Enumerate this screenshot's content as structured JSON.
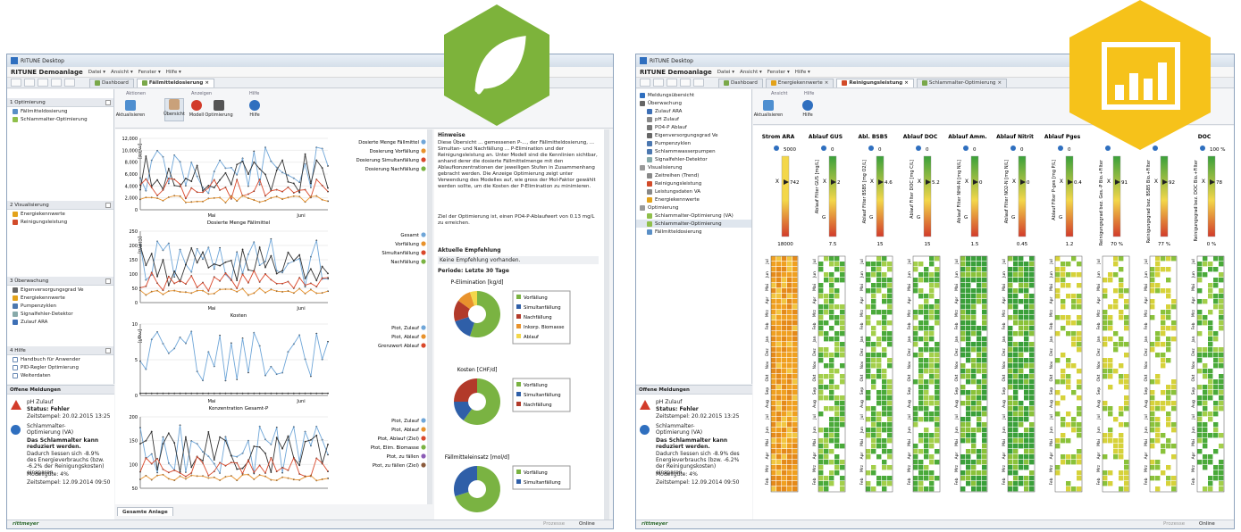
{
  "colors": {
    "green_badge": "#7db33b",
    "yellow_badge": "#f6c21a",
    "blue_line": "#6fa6d8",
    "black_line": "#333333",
    "red_line": "#d9482b",
    "orange_line": "#e8922c",
    "green_line": "#7ab342"
  },
  "left": {
    "title": "RITUNE Desktop",
    "app_name": "RITUNE Demoanlage",
    "menu": [
      "Datei ▾",
      "Ansicht ▾",
      "Fenster ▾",
      "Hilfe ▾"
    ],
    "tabs": [
      "Dashboard",
      "Fällmitteldosierung"
    ],
    "ribbon": {
      "groups": [
        "Aktionen",
        "Anzeigen",
        "Hilfe"
      ],
      "buttons": [
        "Aktualisieren",
        "Übersicht",
        "Modell",
        "Optimierung",
        "Hilfe"
      ]
    },
    "sidebar": [
      {
        "title": "1 Optimierung",
        "items": [
          "Fällmitteldosierung",
          "Schlammalter-Optimierung"
        ]
      },
      {
        "title": "2 Visualisierung",
        "items": [
          "Energiekennwerte",
          "Reinigungsleistung"
        ]
      },
      {
        "title": "3 Überwachung",
        "items": [
          "Eigenversorgungsgrad Ve",
          "Energiekennwerte",
          "Pumpenzyklen",
          "Signalfehler-Detektor",
          "Zulauf ARA"
        ]
      },
      {
        "title": "4 Hilfe",
        "items": [
          "Handbuch für Anwender",
          "PID-Regler Optimierung",
          "Weiterdaten"
        ]
      }
    ],
    "notes": {
      "title": "Offene Meldungen",
      "n1": {
        "name": "pH Zulauf",
        "status": "Status: Fehler",
        "time": "Zeitstempel: 20.02.2015 13:25"
      },
      "n2": {
        "name": "Schlammalter-Optimierung (VA)",
        "bold": "Das Schlammalter kann reduziert werden.",
        "text": "Dadurch liessen sich -8.9% des Energieverbrauchs (bzw. -6.2% der Reinigungskosten) einsparen.",
        "quality": "Modellgüte: 4%",
        "time": "Zeitstempel: 12.09.2014 09:50"
      }
    },
    "charts": [
      {
        "xlabel": "Dosierte Menge Fällmittel",
        "month1": "Mai",
        "month2": "Juni",
        "yticks": [
          "12,000",
          "10,000",
          "8,000",
          "6,000",
          "4,000",
          "2,000",
          "0"
        ],
        "unit": "[m3/d]",
        "legend": [
          "Dosierte Menge Fällmittel",
          "Dosierung Vorfällung",
          "Dosierung Simultanfällung",
          "Dosierung Nachfällung"
        ]
      },
      {
        "xlabel": "Kosten",
        "month1": "Mai",
        "month2": "Juni",
        "yticks": [
          "250",
          "200",
          "150",
          "100",
          "50",
          "0"
        ],
        "unit": "[CHF/d]",
        "legend": [
          "Gesamt",
          "Vorfällung",
          "Simultanfällung",
          "Nachfällung"
        ]
      },
      {
        "xlabel": "Konzentration Gesamt-P",
        "month1": "Mai",
        "month2": "Juni",
        "yticks": [
          "10",
          "5",
          "0"
        ],
        "unit": "[mg/l]",
        "legend": [
          "Ptot, Zulauf",
          "Ptot, Ablauf",
          "Grenzwert Ablauf"
        ]
      },
      {
        "xlabel": "",
        "month1": "",
        "month2": "",
        "yticks": [
          "200",
          "150",
          "100",
          "50"
        ],
        "unit": "",
        "legend": [
          "Ptot, Zulauf",
          "Ptot, Ablauf",
          "Ptot, Ablauf (Ziel)",
          "Ptot, Elim. Biomasse",
          "Ptot, zu fällen",
          "Ptot, zu fällen (Ziel)"
        ]
      }
    ],
    "right": {
      "heading": "Hinweise",
      "text": "Diese Übersicht ... gemessenen P-..., der Fällmitteldosierung, ... Simultan- und Nachfällung ... P-Elimination und der Reinigungsleistung an. Unter Modell sind die Kennlinien sichtbar, anhand derer die dosierte Fällmittelmenge mit den Ablaufkonzentrationen der jeweiligen Stufen in Zusammenhang gebracht werden. Die Anzeige Optimierung zeigt unter Verwendung des Modelles auf, wie gross der Mol-Faktor gewählt werden sollte, um die Kosten der P-Elimination zu minimieren.",
      "goal": "Ziel der Optimierung ist, einen PO4-P-Ablaufwert von 0.13 mg/L zu erreichen.",
      "reco_title": "Aktuelle Empfehlung",
      "reco_text": "Keine Empfehlung vorhanden.",
      "period": "Periode: Letzte 30 Tage",
      "pies": [
        {
          "title": "P-Elimination [kg/d]",
          "legend": [
            "Vorfällung",
            "Simultanfällung",
            "Nachfällung",
            "Inkorp. Biomasse",
            "Ablauf"
          ]
        },
        {
          "title": "Kosten [CHF/d]",
          "legend": [
            "Vorfällung",
            "Simultanfällung",
            "Nachfällung"
          ]
        },
        {
          "title": "Fällmitteleinsatz [mol/d]",
          "legend": [
            "Vorfällung",
            "Simultanfällung"
          ]
        }
      ]
    },
    "bottom_tab": "Gesamte Anlage",
    "status": {
      "brand": "rittmeyer",
      "proc": "Prozesse",
      "online": "Online"
    }
  },
  "right": {
    "title": "RITUNE Desktop",
    "app_name": "RITUNE Demoanlage",
    "menu": [
      "Datei ▾",
      "Ansicht ▾",
      "Fenster ▾",
      "Hilfe ▾"
    ],
    "tabs": [
      "Dashboard",
      "Energiekennwerte",
      "Reinigungsleistung",
      "Schlammalter-Optimierung"
    ],
    "ribbon": {
      "groups": [
        "Ansicht",
        "Hilfe"
      ],
      "buttons": [
        "Aktualisieren",
        "Hilfe"
      ]
    },
    "tree": [
      "Meldungsübersicht",
      "Überwachung",
      "Zulauf ARA",
      "pH Zulauf",
      "PO4-P Ablauf",
      "Eigenversorgungsgrad Ve",
      "Pumpenzyklen",
      "Schlammwasserpumpen",
      "Signalfehler-Detektor",
      "Visualisierung",
      "Zeitreihen (Trend)",
      "Reinigungsleistung",
      "Leistungsdaten VA",
      "Energiekennwerte",
      "Optimierung",
      "Schlammalter-Optimierung (VA)",
      "Schlammalter-Optimierung",
      "Fällmitteldosierung"
    ],
    "notes": {
      "title": "Offene Meldungen",
      "n1": {
        "name": "pH Zulauf",
        "status": "Status: Fehler",
        "time": "Zeitstempel: 20.02.2015 13:25"
      },
      "n2": {
        "name": "Schlammalter-Optimierung (VA)",
        "bold": "Das Schlammalter kann reduziert werden.",
        "text": "Dadurch liessen sich -8.9% des Energieverbrauchs (bzw. -6.2% der Reinigungskosten) einsparen.",
        "quality": "Modellgüte: 4%",
        "time": "Zeitstempel: 12.09.2014 09:50"
      }
    },
    "columns": [
      {
        "name": "Strom ARA",
        "top": "5000",
        "bottom": "18000",
        "val": "742",
        "axis": ""
      },
      {
        "name": "Ablauf GUS",
        "top": "0",
        "bottom": "7.5",
        "val": "2",
        "axis": "Ablauf Filter GUS [mg/L]"
      },
      {
        "name": "Abl. BSB5",
        "top": "0",
        "bottom": "15",
        "val": "4.6",
        "axis": "Ablauf Filter BSB5 [mg O2/L]"
      },
      {
        "name": "Ablauf DOC",
        "top": "0",
        "bottom": "15",
        "val": "5.2",
        "axis": "Ablauf Filter DOC [mg C/L]"
      },
      {
        "name": "Ablauf Amm.",
        "top": "0",
        "bottom": "1.5",
        "val": "0",
        "axis": "Ablauf Filter NH4-N [mg N/L]"
      },
      {
        "name": "Ablauf Nitrit",
        "top": "0",
        "bottom": "0.45",
        "val": "0",
        "axis": "Ablauf Filter NO2-N [mg N/L]"
      },
      {
        "name": "Ablauf Pges",
        "top": "0",
        "bottom": "1.2",
        "val": "0.4",
        "axis": "Ablauf Filter P-ges [mg P/L]"
      },
      {
        "name": "",
        "top": "",
        "bottom": "70 %",
        "val": "91",
        "axis": "Reinigungsgrad bez. Ges.-P Bio.+Filter"
      },
      {
        "name": "",
        "top": "",
        "bottom": "77 %",
        "val": "92",
        "axis": "Reinigungsgrad bez. BSB5 Bio.+Filter"
      },
      {
        "name": "DOC",
        "top": "100 %",
        "bottom": "0 %",
        "val": "78",
        "axis": "Reinigungsgrad bez. DOC Bio.+Filter"
      }
    ],
    "months": [
      "Jul",
      "Jun",
      "Mai",
      "Apr",
      "Mrz",
      "Feb",
      "Jan",
      "Dez",
      "Nov",
      "Okt",
      "Sep",
      "Aug",
      "Jul",
      "Jun",
      "Mai",
      "Apr",
      "Mrz",
      "Feb"
    ],
    "status": {
      "brand": "rittmeyer",
      "proc": "Prozesse",
      "online": "Online"
    }
  }
}
